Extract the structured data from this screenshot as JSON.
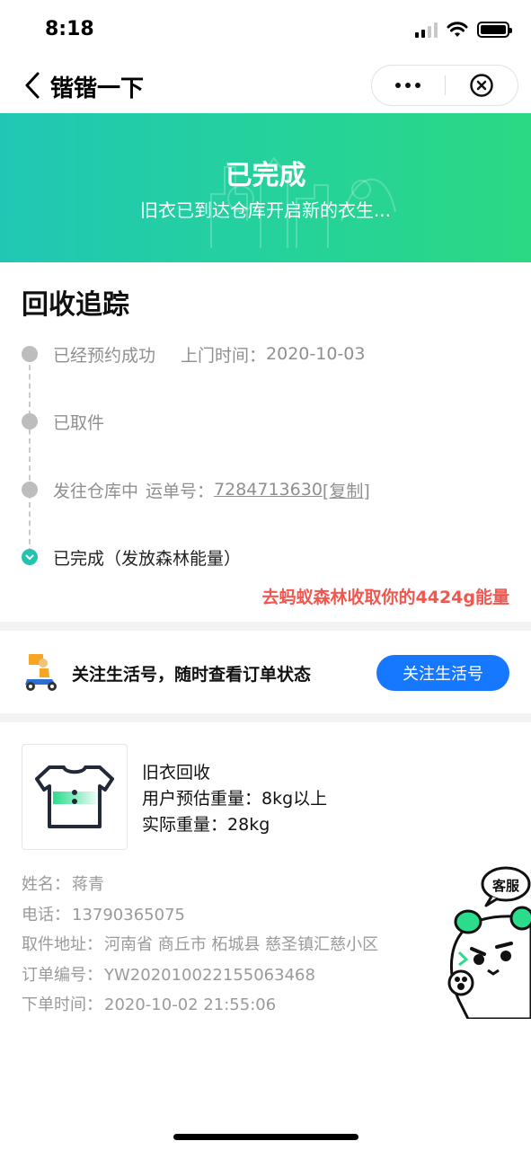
{
  "status_bar": {
    "time": "8:18"
  },
  "nav": {
    "title": "锴锴一下"
  },
  "banner": {
    "title": "已完成",
    "subtitle": "旧衣已到达仓库开启新的衣生..."
  },
  "tracking": {
    "title": "回收追踪",
    "steps": [
      {
        "label": "已经预约成功",
        "extra_label": "上门时间：",
        "extra_value": "2020-10-03"
      },
      {
        "label": "已取件"
      },
      {
        "label": "发往仓库中",
        "extra_label": "运单号：",
        "tracking_no": "7284713630",
        "copy_label": "[复制]"
      },
      {
        "label": "已完成（发放森林能量）"
      }
    ],
    "energy_link": "去蚂蚁森林收取你的4424g能量"
  },
  "follow": {
    "text": "关注生活号，随时查看订单状态",
    "button": "关注生活号"
  },
  "product": {
    "name": "旧衣回收",
    "estimate_label": "用户预估重量：",
    "estimate_value": "8kg以上",
    "actual_label": "实际重量：",
    "actual_value": "28kg"
  },
  "details": [
    {
      "label": "姓名：",
      "value": "蒋青"
    },
    {
      "label": "电话：",
      "value": "13790365075"
    },
    {
      "label": "取件地址：",
      "value": "河南省 商丘市 柘城县 慈圣镇汇慈小区"
    },
    {
      "label": "订单编号：",
      "value": "YW202010022155063468"
    },
    {
      "label": "下单时间：",
      "value": "2020-10-02 21:55:06"
    }
  ],
  "service": {
    "label": "客服"
  },
  "colors": {
    "banner_start": "#21c7b4",
    "banner_end": "#2bd883",
    "primary_button": "#1677ff",
    "energy_link": "#f2574f",
    "step_done": "#23c3b0"
  },
  "icons": [
    "signal-icon",
    "wifi-icon",
    "battery-icon",
    "back-arrow-icon",
    "more-icon",
    "close-icon",
    "delivery-scooter-icon",
    "tshirt-icon",
    "check-icon"
  ]
}
